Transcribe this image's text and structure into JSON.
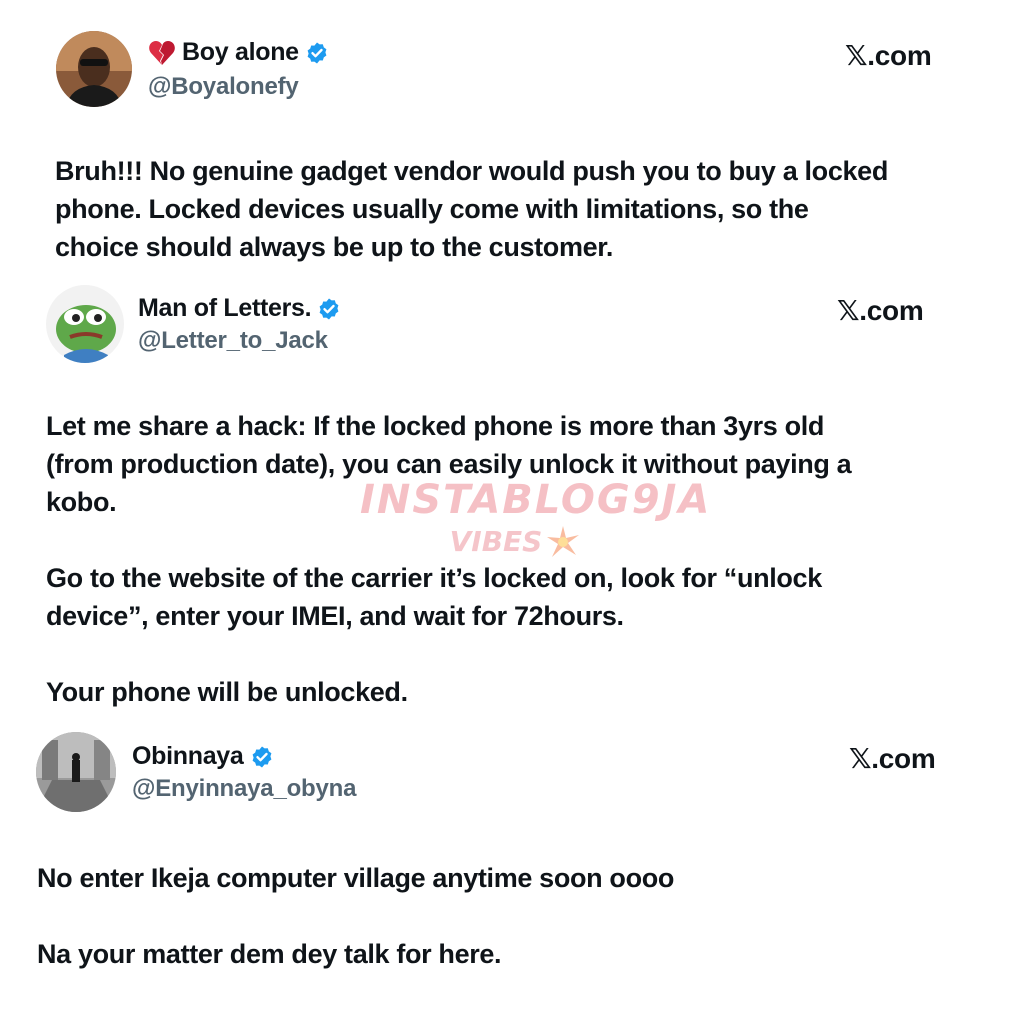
{
  "posts": [
    {
      "display_name": "Boy alone",
      "name_emoji": "broken-heart-emoji",
      "verified": true,
      "handle": "@Boyalonefy",
      "source": "𝕏.com",
      "avatar": "man-in-sunglasses-avatar",
      "lines": [
        "Bruh!!! No genuine gadget vendor would push you to buy a locked",
        "phone. Locked devices usually come with limitations, so the",
        "choice should always be up to the customer."
      ]
    },
    {
      "display_name": "Man of Letters.",
      "verified": true,
      "handle": "@Letter_to_Jack",
      "source": "𝕏.com",
      "avatar": "pepe-frog-avatar",
      "lines": [
        "Let me share a hack: If the locked phone is more than 3yrs old",
        "(from production date), you can easily unlock it without paying a",
        "kobo.",
        "",
        "Go to the website of the carrier it’s locked on, look for “unlock",
        "device”, enter your IMEI, and wait for 72hours.",
        "",
        "Your phone will be unlocked."
      ]
    },
    {
      "display_name": "Obinnaya",
      "verified": true,
      "handle": "@Enyinnaya_obyna",
      "source": "𝕏.com",
      "avatar": "person-in-hallway-avatar",
      "lines": [
        "No enter Ikeja computer village  anytime soon oooo",
        "",
        "Na your matter dem dey talk for here."
      ]
    }
  ],
  "watermark": {
    "main": "INSTABLOG9JA",
    "sub": "VIBES",
    "icon": "sparkle-burst-icon"
  },
  "colors": {
    "text": "#0f1419",
    "handle": "#536471",
    "verified": "#1d9bf0",
    "watermark": "#ec8c96"
  }
}
